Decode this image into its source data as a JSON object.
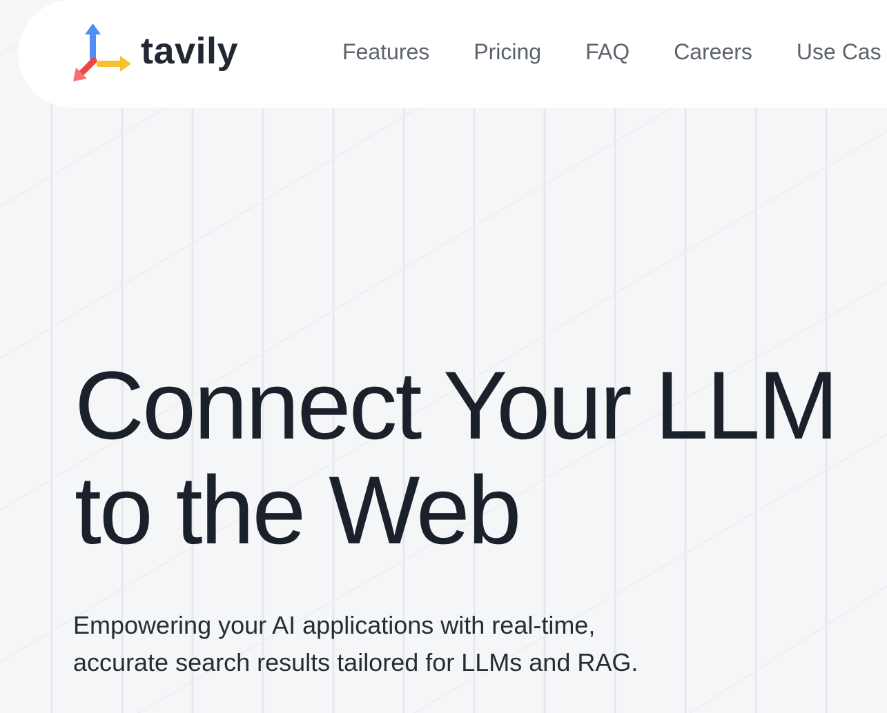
{
  "brand": {
    "name": "tavily",
    "logo_icon": "tavily-arrows-logo-icon",
    "colors": {
      "blue_arrow": "#4f8ef7",
      "yellow_arrow": "#f7c12e",
      "red_arrow": "#ef4444"
    }
  },
  "nav": {
    "items": [
      {
        "label": "Features"
      },
      {
        "label": "Pricing"
      },
      {
        "label": "FAQ"
      },
      {
        "label": "Careers"
      },
      {
        "label": "Use Cas"
      }
    ]
  },
  "hero": {
    "title_line1": "Connect Your LLM",
    "title_line2": "to the Web",
    "subtitle_line1": "Empowering your AI applications with real-time,",
    "subtitle_line2": "accurate search results tailored for LLMs and RAG."
  },
  "theme": {
    "background": "#f5f6f8",
    "navbar_bg": "#ffffff",
    "text_dark": "#1b212b",
    "nav_text": "#5c636c"
  }
}
